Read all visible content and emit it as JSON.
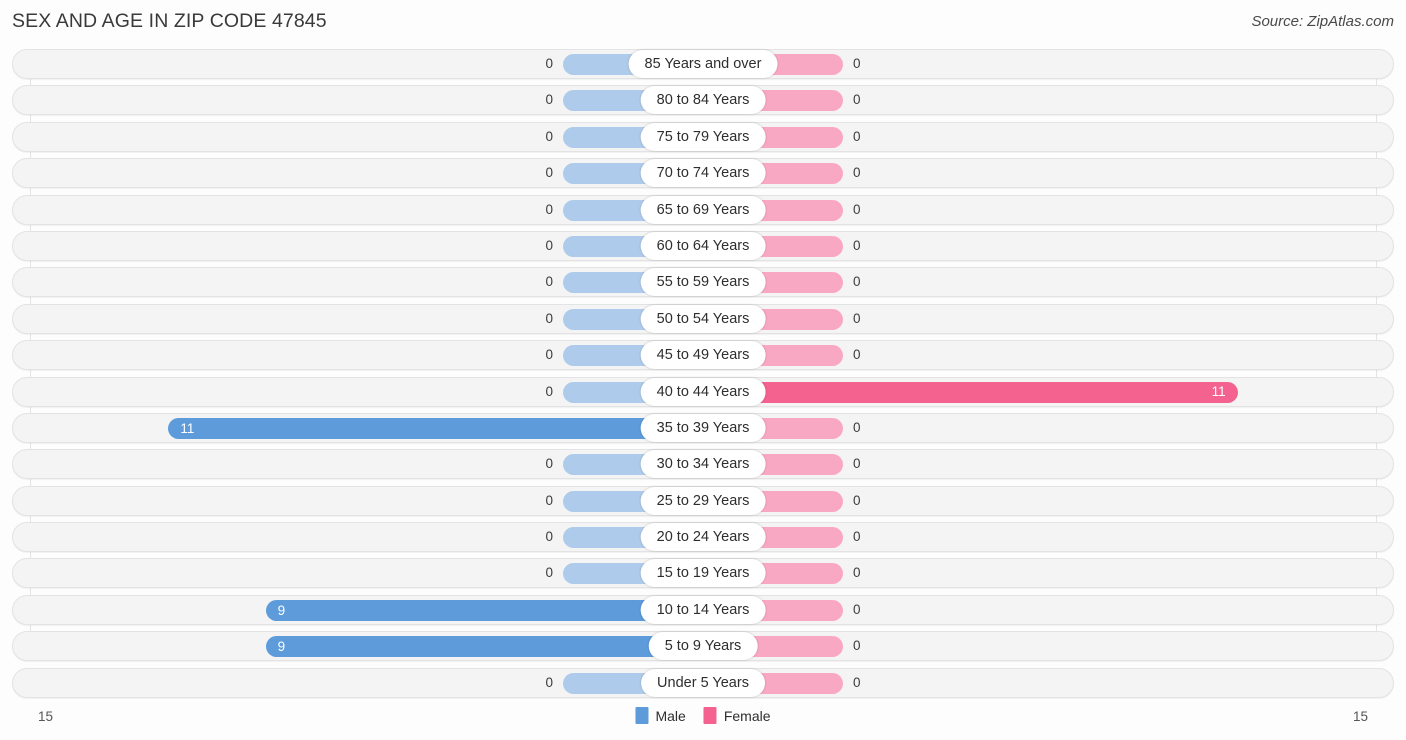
{
  "header": {
    "title": "SEX AND AGE IN ZIP CODE 47845",
    "source": "Source: ZipAtlas.com"
  },
  "legend": {
    "male_label": "Male",
    "female_label": "Female",
    "male_color": "#5d9bdb",
    "female_color": "#f4628f"
  },
  "axis": {
    "left_max": "15",
    "right_max": "15"
  },
  "colors": {
    "male_bar": "#5d9bdb",
    "female_bar": "#f4628f",
    "male_zero": "#aecbeb",
    "female_zero": "#f9a8c4",
    "track": "#f4f4f4"
  },
  "chart_data": {
    "type": "bar",
    "subtype": "population-pyramid",
    "title": "SEX AND AGE IN ZIP CODE 47845",
    "xlabel": "",
    "ylabel": "",
    "xlim": [
      15,
      15
    ],
    "grid": true,
    "legend_position": "bottom-center",
    "categories": [
      "85 Years and over",
      "80 to 84 Years",
      "75 to 79 Years",
      "70 to 74 Years",
      "65 to 69 Years",
      "60 to 64 Years",
      "55 to 59 Years",
      "50 to 54 Years",
      "45 to 49 Years",
      "40 to 44 Years",
      "35 to 39 Years",
      "30 to 34 Years",
      "25 to 29 Years",
      "20 to 24 Years",
      "15 to 19 Years",
      "10 to 14 Years",
      "5 to 9 Years",
      "Under 5 Years"
    ],
    "series": [
      {
        "name": "Male",
        "values": [
          0,
          0,
          0,
          0,
          0,
          0,
          0,
          0,
          0,
          0,
          11,
          0,
          0,
          0,
          0,
          9,
          9,
          0
        ]
      },
      {
        "name": "Female",
        "values": [
          0,
          0,
          0,
          0,
          0,
          0,
          0,
          0,
          0,
          11,
          0,
          0,
          0,
          0,
          0,
          0,
          0,
          0
        ]
      }
    ]
  },
  "rows": [
    {
      "label": "85 Years and over",
      "male": "0",
      "female": "0"
    },
    {
      "label": "80 to 84 Years",
      "male": "0",
      "female": "0"
    },
    {
      "label": "75 to 79 Years",
      "male": "0",
      "female": "0"
    },
    {
      "label": "70 to 74 Years",
      "male": "0",
      "female": "0"
    },
    {
      "label": "65 to 69 Years",
      "male": "0",
      "female": "0"
    },
    {
      "label": "60 to 64 Years",
      "male": "0",
      "female": "0"
    },
    {
      "label": "55 to 59 Years",
      "male": "0",
      "female": "0"
    },
    {
      "label": "50 to 54 Years",
      "male": "0",
      "female": "0"
    },
    {
      "label": "45 to 49 Years",
      "male": "0",
      "female": "0"
    },
    {
      "label": "40 to 44 Years",
      "male": "0",
      "female": "11"
    },
    {
      "label": "35 to 39 Years",
      "male": "11",
      "female": "0"
    },
    {
      "label": "30 to 34 Years",
      "male": "0",
      "female": "0"
    },
    {
      "label": "25 to 29 Years",
      "male": "0",
      "female": "0"
    },
    {
      "label": "20 to 24 Years",
      "male": "0",
      "female": "0"
    },
    {
      "label": "15 to 19 Years",
      "male": "0",
      "female": "0"
    },
    {
      "label": "10 to 14 Years",
      "male": "9",
      "female": "0"
    },
    {
      "label": "5 to 9 Years",
      "male": "9",
      "female": "0"
    },
    {
      "label": "Under 5 Years",
      "male": "0",
      "female": "0"
    }
  ]
}
